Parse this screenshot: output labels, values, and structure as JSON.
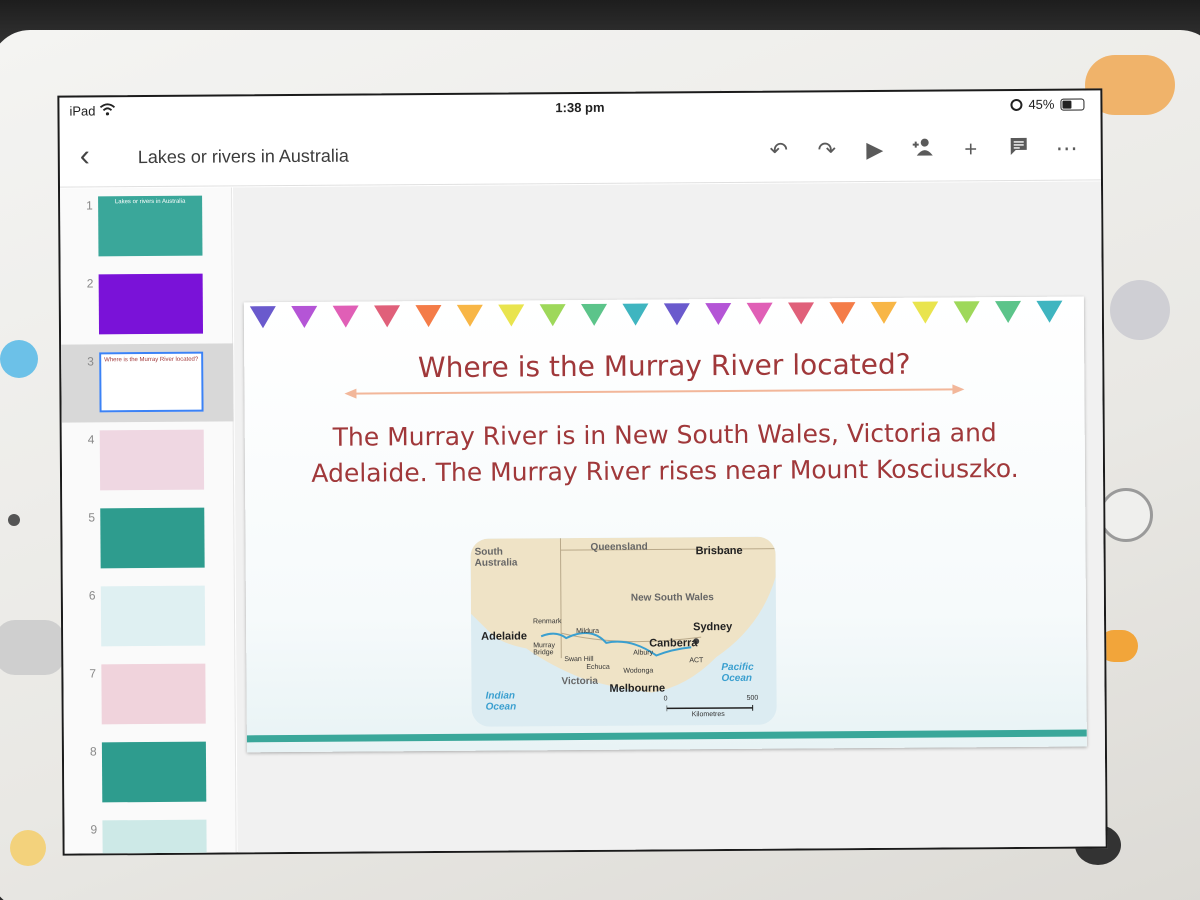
{
  "status": {
    "carrier": "iPad",
    "time": "1:38 pm",
    "battery": "45%",
    "battery_level": 0.45
  },
  "toolbar": {
    "title": "Lakes or rivers in Australia"
  },
  "filmstrip": {
    "slides": [
      {
        "num": "1",
        "text": "Lakes or rivers in Australia",
        "bg": "#3aa79a"
      },
      {
        "num": "2",
        "text": "",
        "bg": "#7a12d8"
      },
      {
        "num": "3",
        "text": "Where is the Murray River located?",
        "bg": "#ffffff"
      },
      {
        "num": "4",
        "text": "",
        "bg": "#efd7e2"
      },
      {
        "num": "5",
        "text": "",
        "bg": "#2e9c8e"
      },
      {
        "num": "6",
        "text": "",
        "bg": "#dff0f2"
      },
      {
        "num": "7",
        "text": "",
        "bg": "#f0d3dc"
      },
      {
        "num": "8",
        "text": "",
        "bg": "#2e9c8e"
      },
      {
        "num": "9",
        "text": "",
        "bg": "#cde9e7"
      }
    ],
    "selected": 2
  },
  "slide": {
    "heading": "Where is the Murray River located?",
    "body": "The Murray River is in New South Wales, Victoria and Adelaide. The Murray River rises near Mount Kosciuszko.",
    "bunting_colors": [
      "#6a5acd",
      "#b455d6",
      "#e05fb6",
      "#e0607a",
      "#f47c48",
      "#f8b646",
      "#e9e44e",
      "#9ed85a",
      "#5cc48a",
      "#3fb5c0"
    ]
  },
  "map": {
    "labels": {
      "south_australia": "South Australia",
      "queensland": "Queensland",
      "brisbane": "Brisbane",
      "nsw": "New South Wales",
      "renmark": "Renmark",
      "mildura": "Mildura",
      "sydney": "Sydney",
      "adelaide": "Adelaide",
      "murray_bridge": "Murray Bridge",
      "swan_hill": "Swan Hill",
      "albury": "Albury",
      "canberra": "Canberra",
      "act": "ACT",
      "echuca": "Echuca",
      "wodonga": "Wodonga",
      "victoria": "Victoria",
      "melbourne": "Melbourne",
      "indian_ocean": "Indian Ocean",
      "pacific_ocean": "Pacific Ocean",
      "scale_zero": "0",
      "scale_max": "500",
      "scale_unit": "Kilometres"
    }
  }
}
